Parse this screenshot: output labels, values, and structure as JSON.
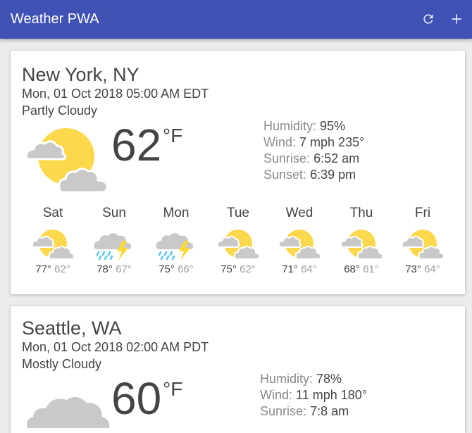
{
  "app": {
    "title": "Weather PWA",
    "refresh_icon": "refresh-icon",
    "add_icon": "plus-icon"
  },
  "cards": [
    {
      "location": "New York, NY",
      "date": "Mon, 01 Oct 2018 05:00 AM EDT",
      "description": "Partly Cloudy",
      "icon": "partly-cloudy-day-icon",
      "temperature": "62",
      "unit": "°F",
      "humidity_label": "Humidity:",
      "humidity": "95%",
      "wind_label": "Wind:",
      "wind": "7 mph 235°",
      "sunrise_label": "Sunrise:",
      "sunrise": "6:52 am",
      "sunset_label": "Sunset:",
      "sunset": "6:39 pm",
      "forecast": [
        {
          "day": "Sat",
          "icon": "partly-cloudy-icon",
          "high": "77°",
          "low": "62°"
        },
        {
          "day": "Sun",
          "icon": "thunderstorm-icon",
          "high": "78°",
          "low": "67°"
        },
        {
          "day": "Mon",
          "icon": "thunderstorm-icon",
          "high": "75°",
          "low": "66°"
        },
        {
          "day": "Tue",
          "icon": "partly-cloudy-icon",
          "high": "75°",
          "low": "62°"
        },
        {
          "day": "Wed",
          "icon": "partly-cloudy-icon",
          "high": "71°",
          "low": "64°"
        },
        {
          "day": "Thu",
          "icon": "partly-cloudy-icon",
          "high": "68°",
          "low": "61°"
        },
        {
          "day": "Fri",
          "icon": "partly-cloudy-icon",
          "high": "73°",
          "low": "64°"
        }
      ]
    },
    {
      "location": "Seattle, WA",
      "date": "Mon, 01 Oct 2018 02:00 AM PDT",
      "description": "Mostly Cloudy",
      "icon": "cloudy-icon",
      "temperature": "60",
      "unit": "°F",
      "humidity_label": "Humidity:",
      "humidity": "78%",
      "wind_label": "Wind:",
      "wind": "11 mph 180°",
      "sunrise_label": "Sunrise:",
      "sunrise": "7:8 am"
    }
  ],
  "colors": {
    "appbar": "#3f51b5",
    "sun": "#fbd84c",
    "cloud": "#c9c9c9",
    "bolt": "#fdd835",
    "rain": "#4fc3f7"
  }
}
